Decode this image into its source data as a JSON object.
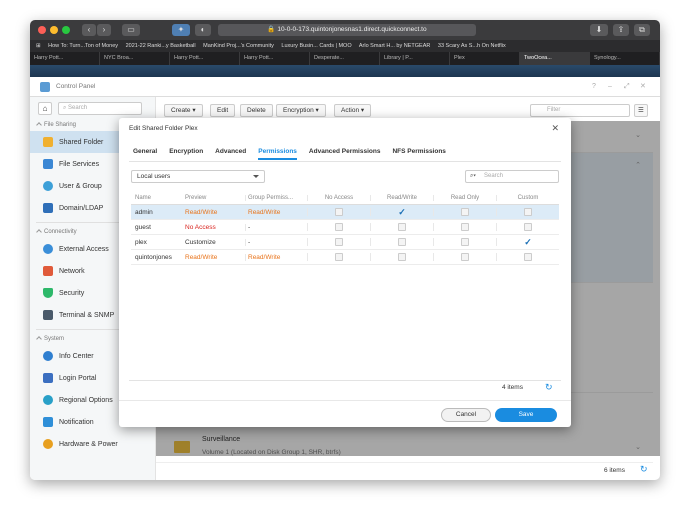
{
  "browser": {
    "url": "10-0-0-173.quintonjonesnas1.direct.quickconnect.to",
    "bookmarks": [
      "How To: Turn...Ton of Money",
      "2021-22 Ranki...y Basketball",
      "ManKind Proj...'s Community",
      "Luxury Busin... Cards | MOO",
      "Arlo Smart H... by NETGEAR",
      "33 Scary As S...h On Netflix"
    ],
    "tabs": [
      "Harry Pott...",
      "NYC Broa...",
      "Harry Pott...",
      "Harry Pott...",
      "Desperate...",
      "Library | P...",
      "Plex",
      "TwoOcea...",
      "Synology..."
    ],
    "active_tab": 7
  },
  "cp": {
    "title": "Control Panel",
    "search_placeholder": "Search",
    "sections": {
      "file_sharing": "File Sharing",
      "connectivity": "Connectivity",
      "system": "System"
    },
    "items": {
      "shared_folder": "Shared Folder",
      "file_services": "File Services",
      "user_group": "User & Group",
      "domain": "Domain/LDAP",
      "external": "External Access",
      "network": "Network",
      "security": "Security",
      "terminal": "Terminal & SNMP",
      "info": "Info Center",
      "login": "Login Portal",
      "regional": "Regional Options",
      "notification": "Notification",
      "hardware": "Hardware & Power"
    },
    "toolbar": {
      "create": "Create ▾",
      "edit": "Edit",
      "delete": "Delete",
      "encryption": "Encryption ▾",
      "action": "Action ▾",
      "filter_placeholder": "Filter"
    },
    "folder_row": {
      "name": "Surveillance",
      "location": "Volume 1 (Located on Disk Group 1, SHR, btrfs)"
    },
    "count": "6 items"
  },
  "modal": {
    "title": "Edit Shared Folder Plex",
    "tabs": [
      "General",
      "Encryption",
      "Advanced",
      "Permissions",
      "Advanced Permissions",
      "NFS Permissions"
    ],
    "active_tab": 3,
    "user_type": "Local users",
    "search_placeholder": "Search",
    "columns": [
      "Name",
      "Preview",
      "Group Permiss...",
      "No Access",
      "Read/Write",
      "Read Only",
      "Custom"
    ],
    "rows": [
      {
        "name": "admin",
        "preview": "Read/Write",
        "group": "Read/Write",
        "checked": "rw"
      },
      {
        "name": "guest",
        "preview": "No Access",
        "group": "-",
        "checked": "none"
      },
      {
        "name": "plex",
        "preview": "Customize",
        "group": "-",
        "checked": "custom"
      },
      {
        "name": "quintonjones",
        "preview": "Read/Write",
        "group": "Read/Write",
        "checked": "none"
      }
    ],
    "count": "4 items",
    "cancel": "Cancel",
    "save": "Save"
  },
  "colors": {
    "accent": "#1a8ce0",
    "orange": "#e8731a",
    "red": "#d9241f"
  }
}
